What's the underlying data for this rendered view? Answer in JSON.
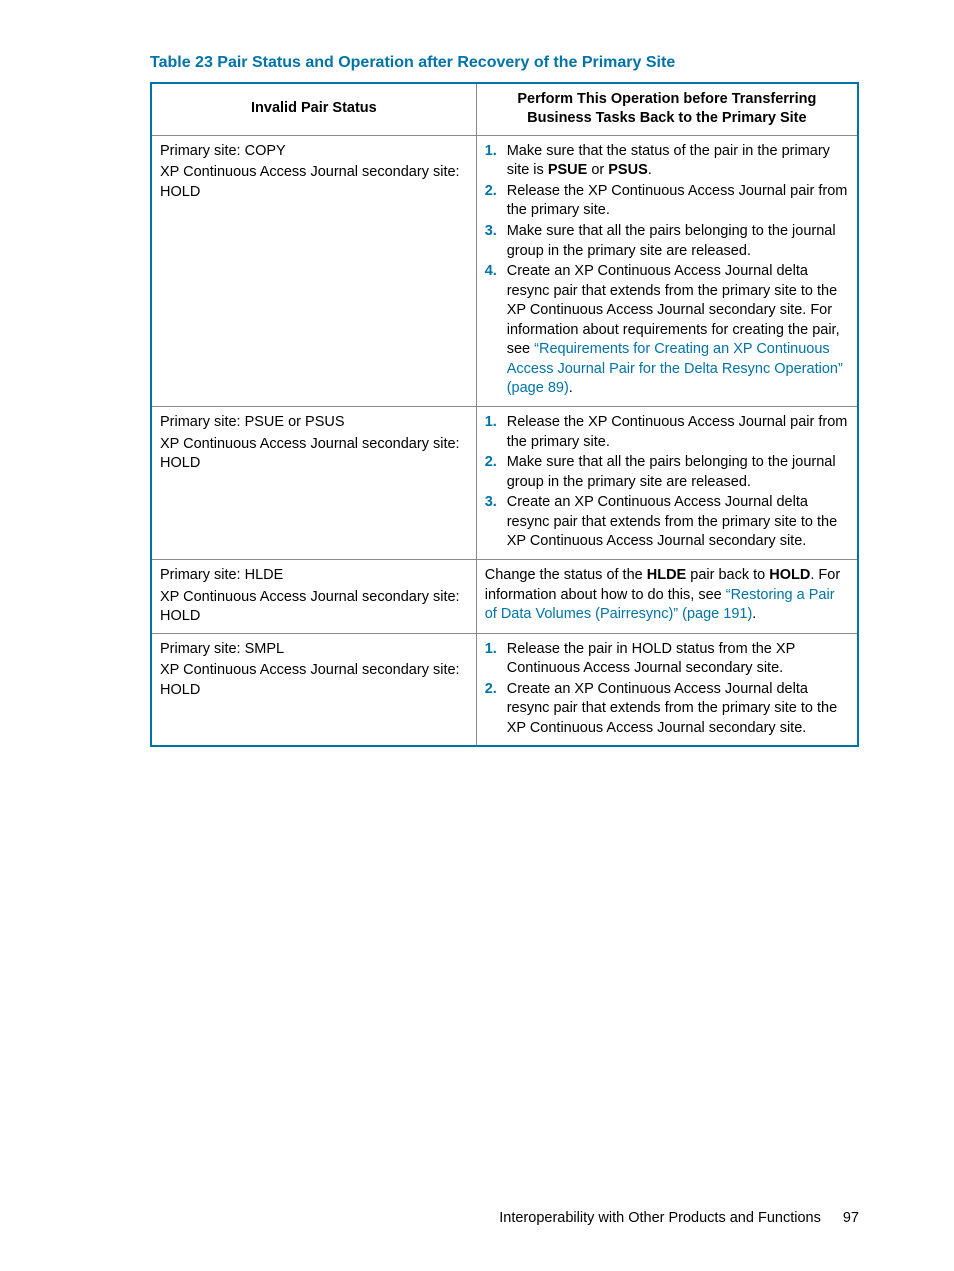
{
  "caption": "Table 23 Pair Status and Operation after Recovery of the Primary Site",
  "headers": {
    "col1": "Invalid Pair Status",
    "col2": "Perform This Operation before Transferring Business Tasks Back to the Primary Site"
  },
  "rows": [
    {
      "status_primary": "Primary site: COPY",
      "status_secondary": "XP Continuous Access Journal secondary site: HOLD",
      "op": {
        "type": "list",
        "items": [
          {
            "pre": "Make sure that the status of the pair in the primary site is ",
            "b1": "PSUE",
            "mid": " or ",
            "b2": "PSUS",
            "post": "."
          },
          {
            "text": "Release the XP Continuous Access Journal pair from the primary site."
          },
          {
            "text": "Make sure that all the pairs belonging to the journal group in the primary site are released."
          },
          {
            "pre": "Create an XP Continuous Access Journal delta resync pair that extends from the primary site to the XP Continuous Access Journal secondary site. For information about requirements for creating the pair, see ",
            "link": "“Requirements for Creating an XP Continuous Access Journal Pair for the Delta Resync Operation” (page 89)",
            "post": "."
          }
        ]
      }
    },
    {
      "status_primary": "Primary site: PSUE or PSUS",
      "status_secondary": "XP Continuous Access Journal secondary site: HOLD",
      "op": {
        "type": "list",
        "items": [
          {
            "text": "Release the XP Continuous Access Journal pair from the primary site."
          },
          {
            "text": "Make sure that all the pairs belonging to the journal group in the primary site are released."
          },
          {
            "text": "Create an XP Continuous Access Journal delta resync pair that extends from the primary site to the XP Continuous Access Journal secondary site."
          }
        ]
      }
    },
    {
      "status_primary": "Primary site: HLDE",
      "status_secondary": "XP Continuous Access Journal secondary site: HOLD",
      "op": {
        "type": "para",
        "pre": "Change the status of the ",
        "b1": "HLDE",
        "mid": " pair back to ",
        "b2": "HOLD",
        "mid2": ". For information about how to do this, see ",
        "link": "“Restoring a Pair of Data Volumes (Pairresync)” (page 191)",
        "post": "."
      }
    },
    {
      "status_primary": "Primary site: SMPL",
      "status_secondary": "XP Continuous Access Journal secondary site: HOLD",
      "op": {
        "type": "list",
        "items": [
          {
            "text": "Release the pair in HOLD status from the XP Continuous Access Journal secondary site."
          },
          {
            "text": "Create an XP Continuous Access Journal delta resync pair that extends from the primary site to the XP Continuous Access Journal secondary site."
          }
        ]
      }
    }
  ],
  "footer": {
    "text": "Interoperability with Other Products and Functions",
    "page": "97"
  }
}
